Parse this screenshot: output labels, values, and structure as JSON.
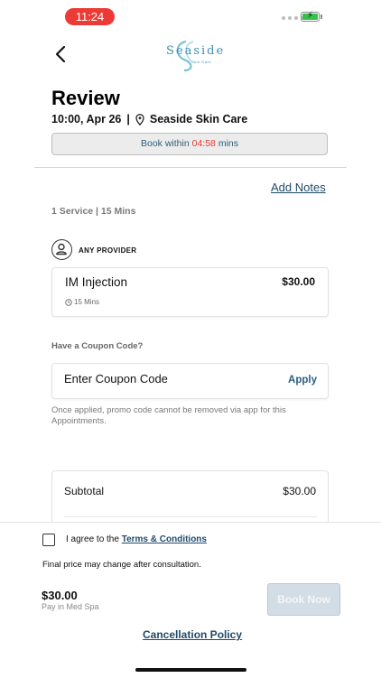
{
  "status_bar": {
    "time": "11:24"
  },
  "header": {
    "logo_text": "Seaside",
    "logo_subtext": "Skin Care"
  },
  "review": {
    "title": "Review",
    "datetime": "10:00, Apr 26",
    "separator": "|",
    "location": "Seaside Skin Care",
    "timer": {
      "prefix": "Book within",
      "countdown": "04:58",
      "suffix": "mins"
    }
  },
  "actions": {
    "add_notes": "Add Notes"
  },
  "summary": {
    "service_count": "1 Service | 15 Mins"
  },
  "provider": {
    "label": "ANY PROVIDER"
  },
  "services": [
    {
      "name": "IM Injection",
      "price": "$30.00",
      "duration": "15 Mins"
    }
  ],
  "coupon": {
    "question": "Have a Coupon Code?",
    "placeholder": "Enter Coupon Code",
    "apply_label": "Apply",
    "note": "Once applied, promo code cannot be removed via app for this Appointments."
  },
  "totals": {
    "subtotal_label": "Subtotal",
    "subtotal_value": "$30.00"
  },
  "footer": {
    "agree_prefix": "I agree to the",
    "terms_link": "Terms & Conditions",
    "final_note": "Final price may change after consultation.",
    "total": "$30.00",
    "pay_in": "Pay in Med Spa",
    "book_now": "Book Now",
    "cancellation_policy": "Cancellation Policy"
  },
  "colors": {
    "accent": "#1f4a6a",
    "countdown": "#e53935",
    "time_pill": "#ec3a36",
    "battery": "#35c24a"
  },
  "icons": [
    "back-chevron-icon",
    "location-pin-icon",
    "person-icon",
    "clock-icon",
    "checkbox-icon",
    "battery-icon",
    "signal-icon"
  ]
}
